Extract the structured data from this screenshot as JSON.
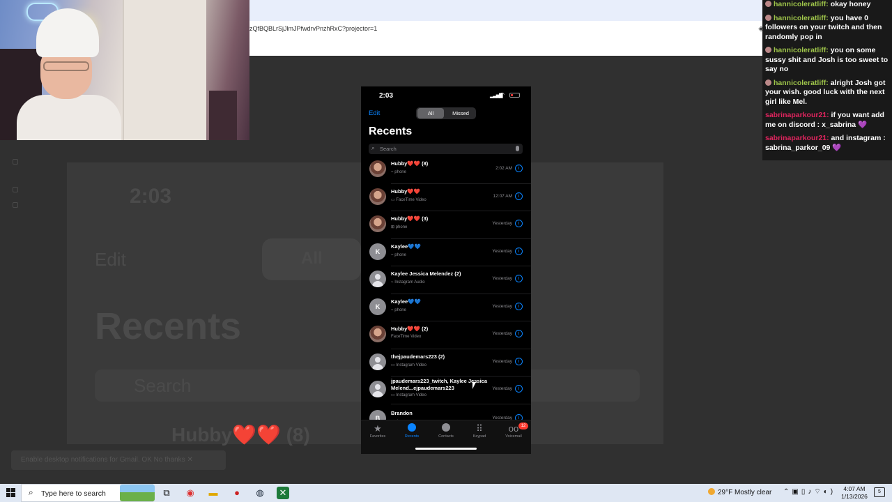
{
  "browser": {
    "url": "zQfBQBLrSjJlmJPfwdrvPnzhRxC?projector=1"
  },
  "background": {
    "big_time": "2:03",
    "big_edit": "Edit",
    "big_all": "All",
    "big_title": "Recents",
    "big_search": "Search",
    "big_row": "Hubby❤️❤️ (8)",
    "toast_text": "Enable desktop notifications for Gmail.   OK   No thanks   ✕"
  },
  "chat": [
    {
      "user": "hannicoleratliff:",
      "text": "okay honey",
      "color": "green"
    },
    {
      "user": "hannicoleratliff:",
      "text": "you have 0 followers on your twitch and then randomly pop in",
      "color": "green"
    },
    {
      "user": "hannicoleratliff:",
      "text": "you on some sussy shit and Josh is too sweet to say no",
      "color": "green"
    },
    {
      "user": "hannicoleratliff:",
      "text": "alright Josh got your wish. good luck with the next girl like Mel.",
      "color": "green"
    },
    {
      "user": "sabrinaparkour21:",
      "text": "if you want add me on discord : x_sabrina",
      "emote": "💜",
      "color": "red"
    },
    {
      "user": "sabrinaparkour21:",
      "text": "and instagram : sabrina_parkor_09",
      "emote": "💜",
      "color": "red"
    }
  ],
  "phone": {
    "time": "2:03",
    "edit": "Edit",
    "segments": {
      "all": "All",
      "missed": "Missed"
    },
    "title": "Recents",
    "search_placeholder": "Search",
    "calls": [
      {
        "name": "Hubby❤️❤️ (8)",
        "type": "phone",
        "when": "2:02 AM",
        "avatar": "photo"
      },
      {
        "name": "Hubby❤️❤️",
        "type": "FaceTime Video",
        "when": "12:07 AM",
        "avatar": "photo"
      },
      {
        "name": "Hubby❤️❤️ (3)",
        "type": "phone",
        "when": "Yesterday",
        "avatar": "photo"
      },
      {
        "name": "Kaylee💙💙",
        "type": "phone",
        "when": "Yesterday",
        "avatar": "K"
      },
      {
        "name": "Kaylee Jessica Melendez (2)",
        "type": "Instagram Audio",
        "when": "Yesterday",
        "avatar": "blank"
      },
      {
        "name": "Kaylee💙💙",
        "type": "phone",
        "when": "Yesterday",
        "avatar": "K"
      },
      {
        "name": "Hubby❤️❤️ (2)",
        "type": "FaceTime Video",
        "when": "Yesterday",
        "avatar": "photo"
      },
      {
        "name": "thejpaudemars223 (2)",
        "type": "Instagram Video",
        "when": "Yesterday",
        "avatar": "blank"
      },
      {
        "name": "jpaudemars223_twitch, Kaylee Jessica Melend...ejpaudemars223",
        "type": "Instagram Video",
        "when": "Yesterday",
        "avatar": "blank"
      },
      {
        "name": "Brandon",
        "type": "phone",
        "when": "Yesterday",
        "avatar": "B"
      }
    ],
    "tabs": [
      "Favorites",
      "Recents",
      "Contacts",
      "Keypad",
      "Voicemail"
    ],
    "voicemail_badge": "12"
  },
  "taskbar": {
    "search_text": "Type here to search",
    "weather": "29°F  Mostly clear",
    "time": "4:07 AM",
    "date": "1/13/2026",
    "notif_count": "5"
  }
}
